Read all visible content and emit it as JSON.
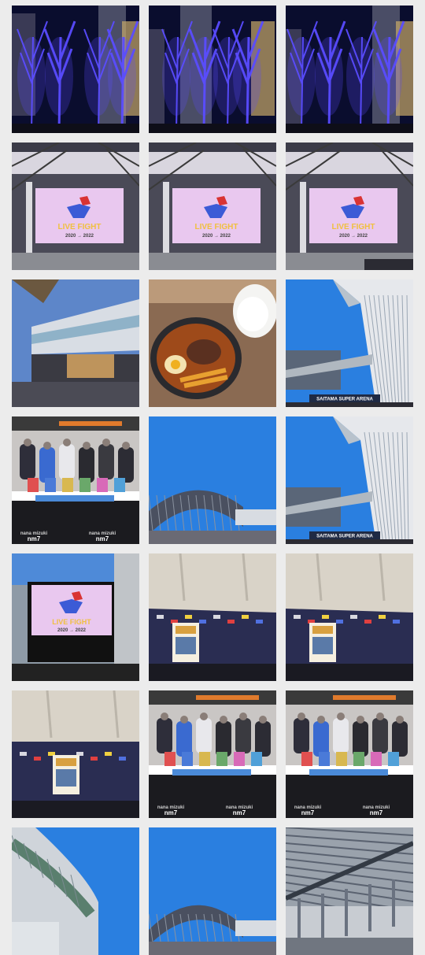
{
  "gallery": {
    "columns": 3,
    "background": "#ececec",
    "photos": [
      {
        "id": "illumination-trees-1",
        "scene": "illumination",
        "variant": 0
      },
      {
        "id": "illumination-trees-2",
        "scene": "illumination",
        "variant": 1
      },
      {
        "id": "illumination-trees-3",
        "scene": "illumination",
        "variant": 2
      },
      {
        "id": "live-banner-screen-1",
        "scene": "screen",
        "variant": 0
      },
      {
        "id": "live-banner-screen-2",
        "scene": "screen",
        "variant": 1
      },
      {
        "id": "live-banner-screen-3",
        "scene": "screen",
        "variant": 2
      },
      {
        "id": "arena-exterior-evening",
        "scene": "arena",
        "variant": 0
      },
      {
        "id": "curry-meal",
        "scene": "curry",
        "variant": 0
      },
      {
        "id": "saitama-super-arena-facade-1",
        "scene": "facade",
        "variant": 0
      },
      {
        "id": "merch-display-1",
        "scene": "merch",
        "variant": 0
      },
      {
        "id": "station-canopy-1",
        "scene": "canopy",
        "variant": 0
      },
      {
        "id": "saitama-super-arena-facade-2",
        "scene": "facade",
        "variant": 1
      },
      {
        "id": "outdoor-banner-board",
        "scene": "board",
        "variant": 0
      },
      {
        "id": "car-models-table-1",
        "scene": "cars",
        "variant": 0
      },
      {
        "id": "car-models-table-2",
        "scene": "cars",
        "variant": 1
      },
      {
        "id": "car-models-table-3",
        "scene": "cars",
        "variant": 2
      },
      {
        "id": "merch-display-2",
        "scene": "merch",
        "variant": 1
      },
      {
        "id": "merch-display-3",
        "scene": "merch",
        "variant": 2
      },
      {
        "id": "arena-curve-blue-sky",
        "scene": "arenaCurve",
        "variant": 0
      },
      {
        "id": "station-canopy-2",
        "scene": "canopy",
        "variant": 1
      },
      {
        "id": "station-concourse-roof",
        "scene": "concourse",
        "variant": 0
      }
    ]
  },
  "texts": {
    "banner_main": "LIVE FIGHT",
    "banner_years": "2020 → 2022",
    "arena_sign": "SAITAMA SUPER ARENA",
    "merch_logo": "nana mizuki",
    "merch_tag": "nm7"
  },
  "colors": {
    "night_sky": "#0a0d2e",
    "led_blue": "#5a4cff",
    "screen_pink": "#e9c8ef",
    "day_sky": "#2a7fe0",
    "cloth_navy": "#2a2d52"
  }
}
